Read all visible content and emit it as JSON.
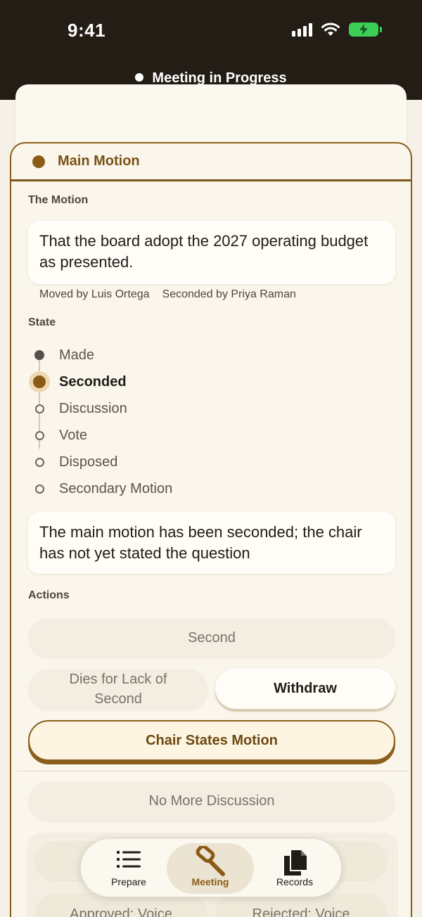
{
  "status_bar": {
    "time": "9:41"
  },
  "header": {
    "title": "Meeting in Progress"
  },
  "motion": {
    "card_title": "Main Motion",
    "section_motion": "The Motion",
    "text": "That the board adopt the 2027 operating budget as presented.",
    "moved_by": "Moved by Luis Ortega",
    "seconded_by": "Seconded by Priya Raman",
    "section_state": "State",
    "states": [
      "Made",
      "Seconded",
      "Discussion",
      "Vote",
      "Disposed",
      "Secondary Motion"
    ],
    "current_state": "Seconded",
    "state_note": "The main motion has been seconded; the chair has not yet stated the question",
    "section_actions": "Actions",
    "actions": {
      "second": "Second",
      "dies": "Dies for Lack of Second",
      "withdraw": "Withdraw",
      "chair_states": "Chair States Motion",
      "no_more_discussion": "No More Discussion",
      "approved_voice": "Approved: Voice",
      "rejected_voice": "Rejected: Voice"
    }
  },
  "tabs": [
    {
      "label": "Prepare",
      "icon": "list-icon"
    },
    {
      "label": "Meeting",
      "icon": "gavel-icon",
      "active": true
    },
    {
      "label": "Records",
      "icon": "documents-icon"
    }
  ],
  "colors": {
    "accent": "#8a5a17",
    "header_bg": "#241d16",
    "background": "#f5f1e6"
  }
}
